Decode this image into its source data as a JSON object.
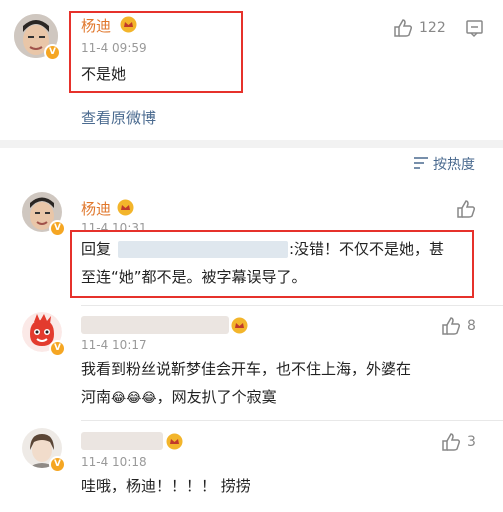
{
  "top_comment": {
    "user": "杨迪",
    "time": "11-4 09:59",
    "text": "不是她",
    "likes": "122",
    "view_original": "查看原微博"
  },
  "sort": {
    "label": "按热度"
  },
  "replies": [
    {
      "user": "杨迪",
      "time": "11-4 10:31",
      "reply_prefix": "回复",
      "text_line1": ":没错！不仅不是她，甚",
      "text_line2": "至连“她”都不是。被字幕误导了。"
    },
    {
      "user": "",
      "time": "11-4 10:17",
      "text_line1": "我看到粉丝说靳梦佳会开车，也不住上海，外婆在",
      "text_line2": "河南",
      "emoji": "😂😂😂",
      "text_line2_tail": "，网友扒了个寂寞",
      "likes": "8"
    },
    {
      "user": "",
      "time": "11-4 10:18",
      "text": "哇哦，杨迪！！！！ 捞捞",
      "likes": "3"
    }
  ],
  "colors": {
    "name": "#e0772c",
    "highlight": "#e6312b",
    "band": "#f2f2f2"
  }
}
